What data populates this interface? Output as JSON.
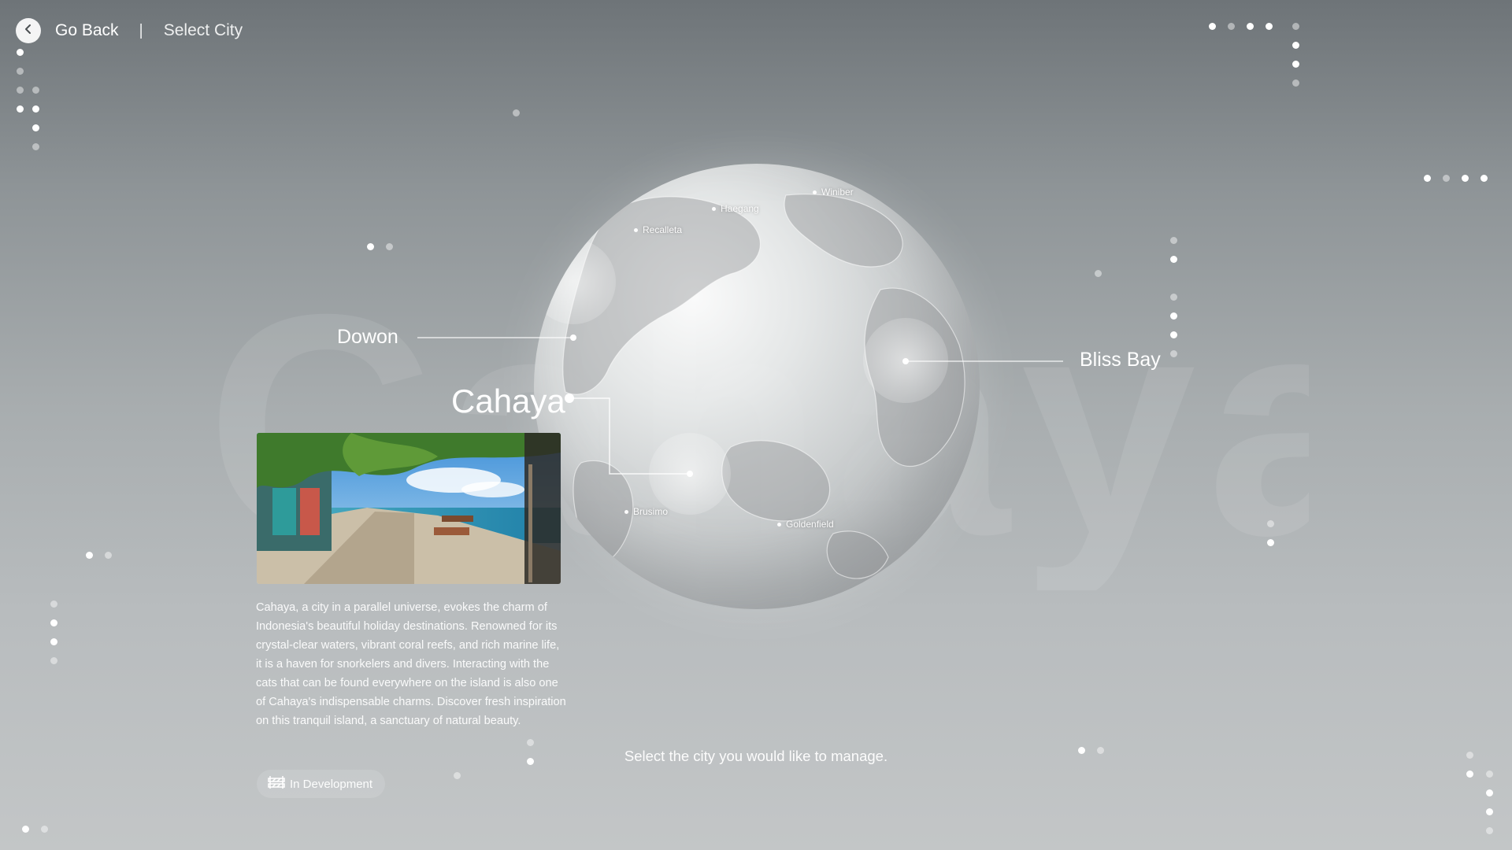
{
  "topbar": {
    "back_icon": "chevron-left-icon",
    "back_label": "Go Back",
    "divider": "|",
    "breadcrumb": "Select City"
  },
  "watermark": "Cahaya",
  "globe": {
    "labels": {
      "winiber": "Winiber",
      "haegang": "Haegang",
      "recalleta": "Recalleta",
      "brusimo": "Brusimo",
      "goldenfield": "Goldenfield"
    }
  },
  "cities": {
    "dowon": "Dowon",
    "bliss_bay": "Bliss Bay",
    "selected": "Cahaya"
  },
  "card": {
    "description": "Cahaya, a city in a parallel universe, evokes the charm of Indonesia's beautiful holiday destinations. Renowned for its crystal-clear waters, vibrant coral reefs, and rich marine life, it is a haven for snorkelers and divers. Interacting with the cats that can be found everywhere on the island is also one of Cahaya's indispensable charms. Discover fresh inspiration on this tranquil island, a sanctuary of natural beauty.",
    "status_icon": "construction-barrier-icon",
    "status": "In Development"
  },
  "prompt": "Select the city you would like to manage."
}
